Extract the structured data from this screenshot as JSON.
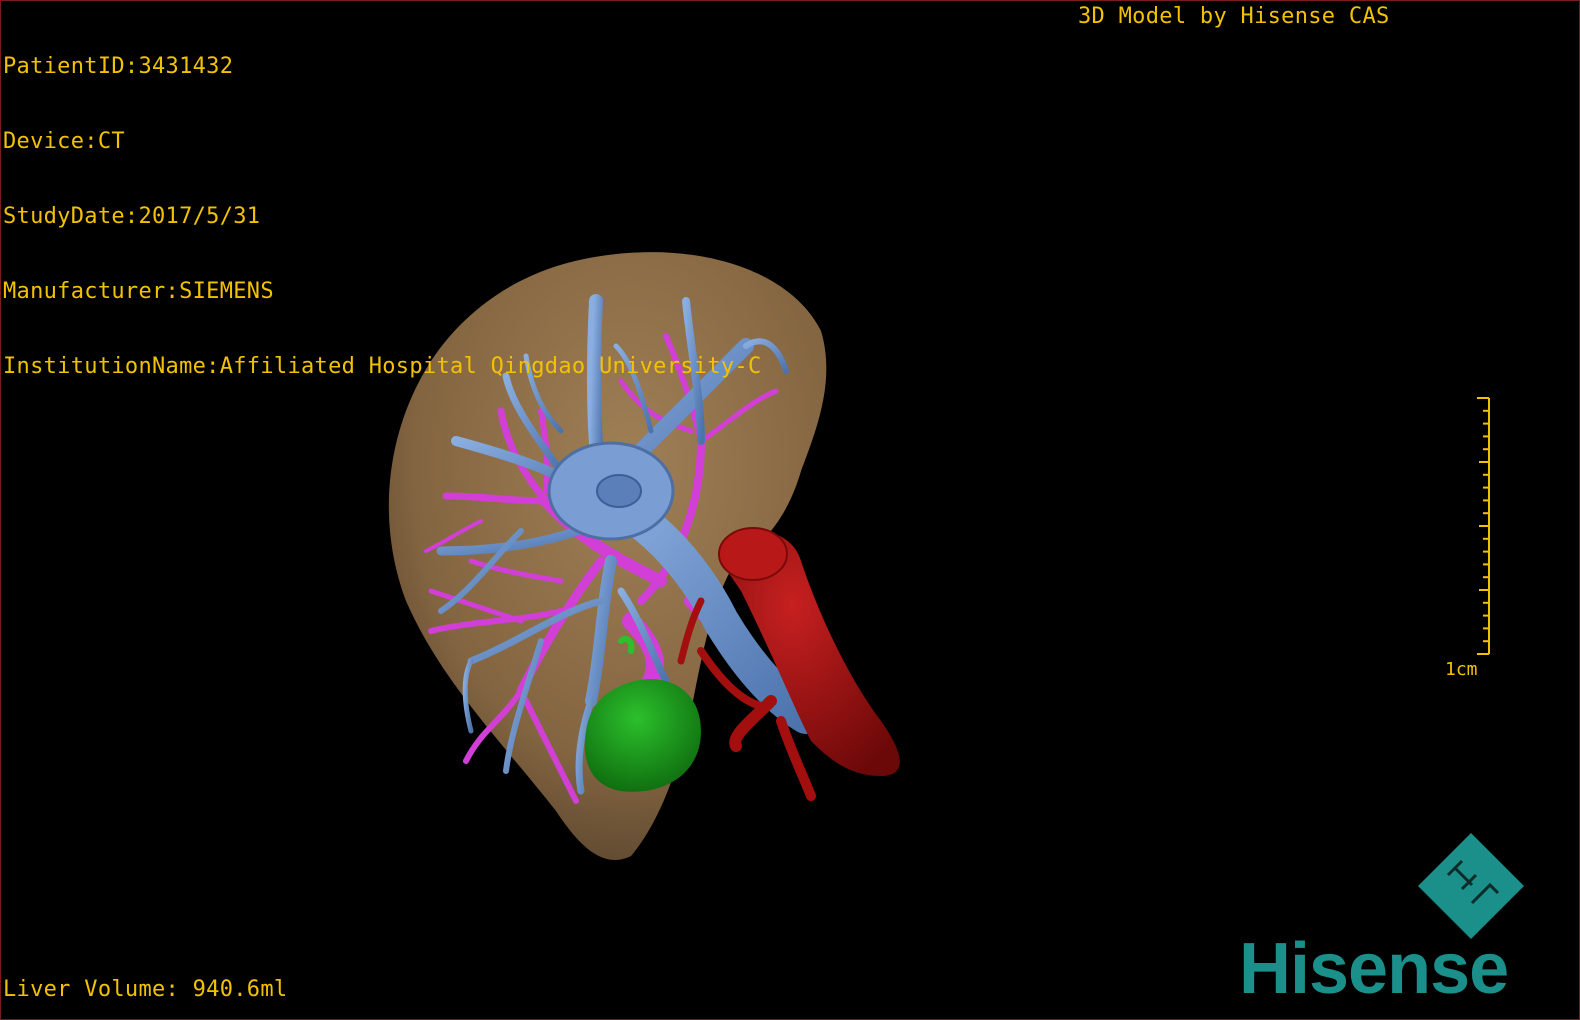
{
  "overlay": {
    "patient_id": "PatientID:3431432",
    "device": "Device:CT",
    "study_date": "StudyDate:2017/5/31",
    "manufacturer": "Manufacturer:SIEMENS",
    "institution": "InstitutionName:Affiliated Hospital Qingdao University-C",
    "credit": "3D Model by Hisense CAS",
    "liver_volume": "Liver Volume: 940.6ml"
  },
  "scale": {
    "label": "1cm"
  },
  "logo": {
    "brand": "Hisense",
    "mark_icon": "hisense-diamond-icon"
  },
  "colors": {
    "overlay_text": "#f2c200",
    "border": "#7a1c1c",
    "liver": "#9c7a4f",
    "hepatic_vein": "#6f93c9",
    "portal_vein": "#d23fd6",
    "inferior_vena_cava": "#a30f0f",
    "lesion": "#1f9d1f",
    "brand": "#1b8f8a"
  }
}
